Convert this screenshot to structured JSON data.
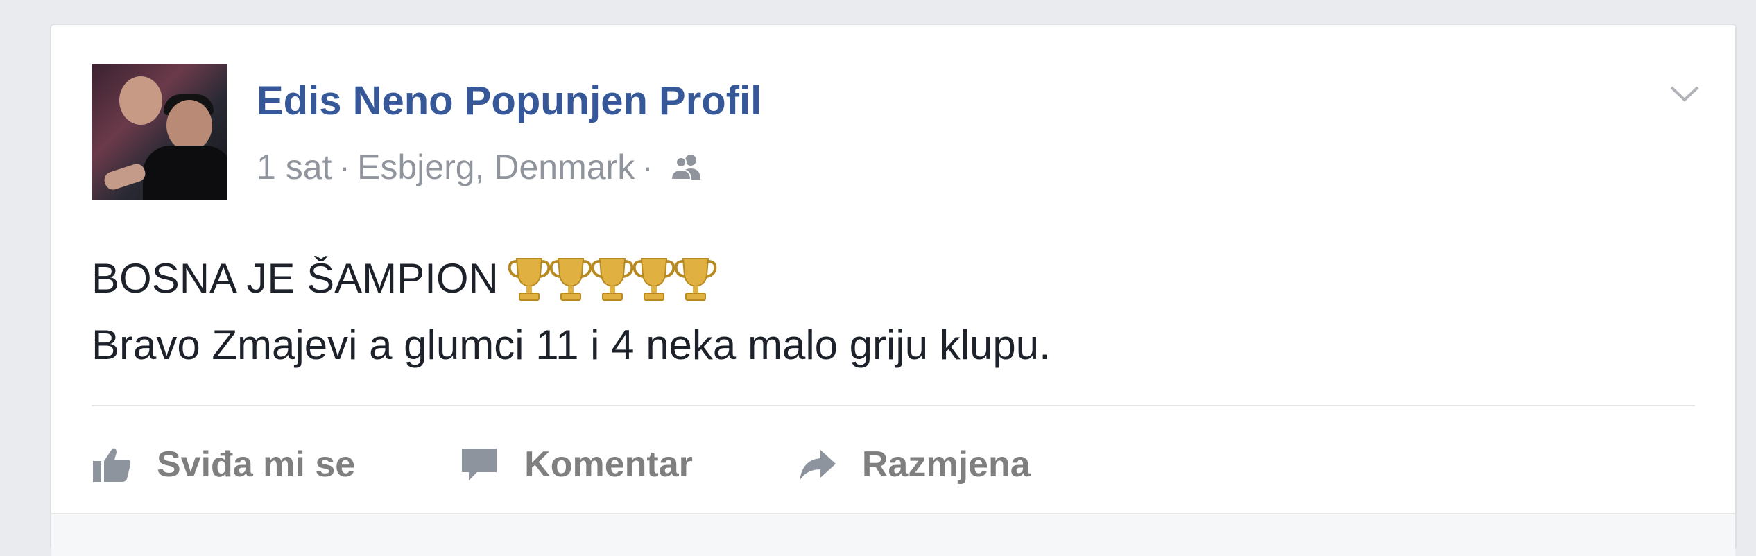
{
  "post": {
    "author": "Edis Neno Popunjen Profil",
    "time": "1 sat",
    "separator": "·",
    "location": "Esbjerg, Denmark",
    "audience_icon": "friends-icon",
    "text_line1": "BOSNA JE ŠAMPION",
    "trophy_count": 5,
    "trophy_icon": "trophy-icon",
    "text_line2": "Bravo Zmajevi a glumci 11 i 4 neka malo griju klupu."
  },
  "actions": {
    "like_label": "Sviđa mi se",
    "comment_label": "Komentar",
    "share_label": "Razmjena"
  },
  "colors": {
    "author": "#365899",
    "meta": "#90949c",
    "text": "#1d2129",
    "action": "#7f7f7f",
    "background": "#e9ebee",
    "trophy": "#e0b040"
  }
}
